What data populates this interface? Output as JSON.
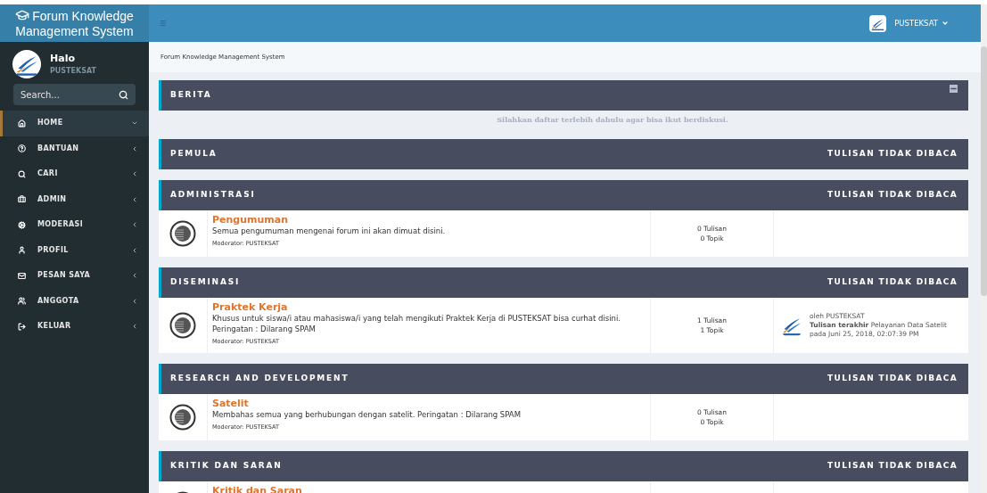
{
  "header": {
    "brand": "Forum Knowledge Management System",
    "user": "PUSTEKSAT"
  },
  "sidebar": {
    "greeting": "Halo",
    "username": "PUSTEKSAT",
    "search": {
      "placeholder": "Search..."
    },
    "items": [
      {
        "label": "HOME",
        "selected": true,
        "expanded": true
      },
      {
        "label": "BANTUAN",
        "selected": false,
        "expanded": false
      },
      {
        "label": "CARI",
        "selected": false,
        "expanded": false
      },
      {
        "label": "ADMIN",
        "selected": false,
        "expanded": false
      },
      {
        "label": "MODERASI",
        "selected": false,
        "expanded": false
      },
      {
        "label": "PROFIL",
        "selected": false,
        "expanded": false
      },
      {
        "label": "PESAN SAYA",
        "selected": false,
        "expanded": false
      },
      {
        "label": "ANGGOTA",
        "selected": false,
        "expanded": false
      },
      {
        "label": "KELUAR",
        "selected": false,
        "expanded": false
      }
    ]
  },
  "breadcrumb": "Forum Knowledge Management System",
  "sections": [
    {
      "title": "BERITA",
      "kind": "news",
      "notice": "Silahkan daftar terlebih dahulu agar bisa ikut berdiskusi."
    },
    {
      "title": "PEMULA",
      "kind": "board",
      "unread_label": "TULISAN TIDAK DIBACA"
    },
    {
      "title": "ADMINISTRASI",
      "kind": "board",
      "unread_label": "TULISAN TIDAK DIBACA",
      "forums": [
        {
          "name": "Pengumuman",
          "description": [
            "Semua pengumuman mengenai forum ini akan dimuat disini."
          ],
          "moderator": "Moderator: PUSTEKSAT",
          "posts": "0 Tulisan",
          "topics": "0 Topik"
        }
      ]
    },
    {
      "title": "DISEMINASI",
      "kind": "board",
      "unread_label": "TULISAN TIDAK DIBACA",
      "forums": [
        {
          "name": "Praktek Kerja",
          "description": [
            "Khusus untuk siswa/i atau mahasiswa/i yang telah mengikuti Praktek Kerja di PUSTEKSAT bisa curhat disini.",
            "Peringatan : Dilarang SPAM"
          ],
          "moderator": "Moderator: PUSTEKSAT",
          "posts": "1 Tulisan",
          "topics": "1 Topik",
          "last_post": {
            "by": "oleh PUSTEKSAT",
            "title": "**Tulisan terakhir** Pelayanan Data Satelit",
            "date": "pada Juni 25, 2018, 02:07:39 PM"
          }
        }
      ]
    },
    {
      "title": "RESEARCH AND DEVELOPMENT",
      "kind": "board",
      "unread_label": "TULISAN TIDAK DIBACA",
      "forums": [
        {
          "name": "Satelit",
          "description": [
            "Membahas semua yang berhubungan dengan satelit. Peringatan : Dilarang SPAM"
          ],
          "moderator": "Moderator: PUSTEKSAT",
          "posts": "0 Tulisan",
          "topics": "0 Topik"
        }
      ]
    },
    {
      "title": "KRITIK DAN SARAN",
      "kind": "board",
      "unread_label": "TULISAN TIDAK DIBACA",
      "forums": [
        {
          "name": "Kritik dan Saran"
        }
      ]
    }
  ]
}
